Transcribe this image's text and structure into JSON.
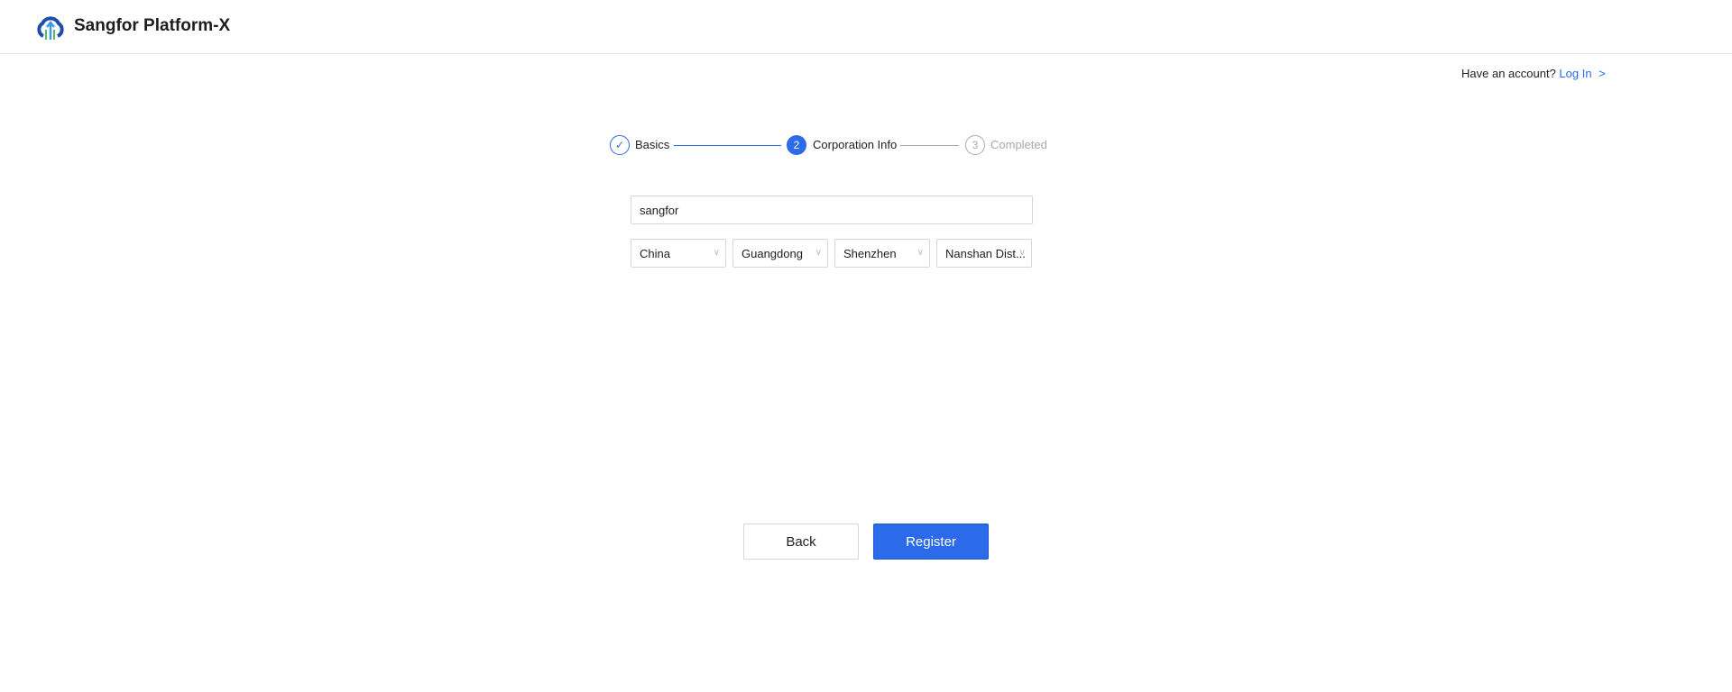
{
  "header": {
    "app_title": "Sangfor Platform-X",
    "logo_icon": "cloud-upload-logo"
  },
  "login": {
    "prompt": "Have an account?",
    "link": "Log In",
    "chevron": ">"
  },
  "steps": [
    {
      "number": "✓",
      "label": "Basics",
      "status": "done"
    },
    {
      "number": "2",
      "label": "Corporation Info",
      "status": "active"
    },
    {
      "number": "3",
      "label": "Completed",
      "status": "pending"
    }
  ],
  "form": {
    "company_name": "sangfor",
    "country": "China",
    "province": "Guangdong",
    "city": "Shenzhen",
    "district": "Nanshan Dist..."
  },
  "buttons": {
    "back": "Back",
    "register": "Register"
  },
  "colors": {
    "accent": "#2b6ae8",
    "border": "#d6d6d6",
    "muted": "#a8a8a8"
  }
}
